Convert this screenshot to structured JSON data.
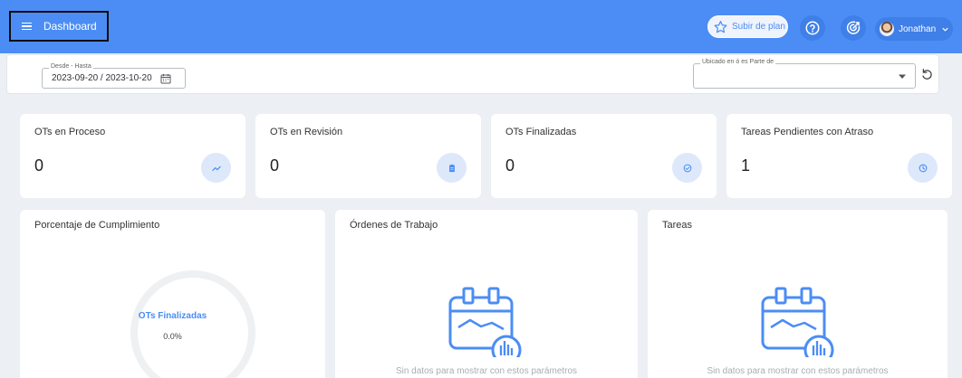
{
  "header": {
    "menu_label": "Dashboard",
    "upgrade_label": "Subir de plan",
    "user_name": "Jonathan",
    "accent": "#4b8df4"
  },
  "filters": {
    "date_label": "Desde - Hasta",
    "date_value": "2023-09-20 / 2023-10-20",
    "location_label": "Ubicado en ó es Parte de",
    "location_value": ""
  },
  "stats": [
    {
      "title": "OTs en Proceso",
      "value": "0",
      "icon": "trend-icon"
    },
    {
      "title": "OTs en Revisión",
      "value": "0",
      "icon": "clipboard-icon"
    },
    {
      "title": "OTs Finalizadas",
      "value": "0",
      "icon": "check-circle-icon"
    },
    {
      "title": "Tareas Pendientes con Atraso",
      "value": "1",
      "icon": "clock-icon"
    }
  ],
  "panels": {
    "compliance": {
      "title": "Porcentaje de Cumplimiento",
      "donut_label": "OTs Finalizadas",
      "donut_value": "0.0%"
    },
    "work_orders": {
      "title": "Órdenes de Trabajo",
      "empty_text": "Sin datos para mostrar con estos parámetros"
    },
    "tasks": {
      "title": "Tareas",
      "empty_text": "Sin datos para mostrar con estos parámetros"
    }
  }
}
